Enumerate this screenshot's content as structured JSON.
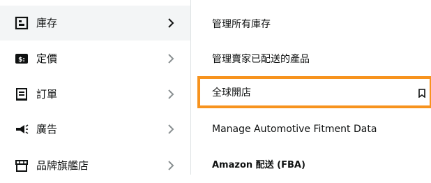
{
  "left_menu": {
    "items": [
      {
        "label": "庫存",
        "icon": "inventory-icon",
        "active": true
      },
      {
        "label": "定價",
        "icon": "pricing-icon",
        "active": false
      },
      {
        "label": "訂單",
        "icon": "orders-icon",
        "active": false
      },
      {
        "label": "廣告",
        "icon": "megaphone-icon",
        "active": false
      },
      {
        "label": "品牌旗艦店",
        "icon": "storefront-icon",
        "active": false
      }
    ]
  },
  "submenu": {
    "items": [
      {
        "label": "管理所有庫存"
      },
      {
        "label": "管理賣家已配送的產品"
      },
      {
        "label": "全球開店",
        "highlighted": true,
        "icon": "bookmark-icon"
      },
      {
        "label": "Manage Automotive Fitment Data"
      },
      {
        "label": "Amazon 配送 (FBA)"
      }
    ]
  },
  "colors": {
    "highlight_border": "#f7931e",
    "active_background": "#f3f5f6",
    "text": "#0f1111"
  }
}
